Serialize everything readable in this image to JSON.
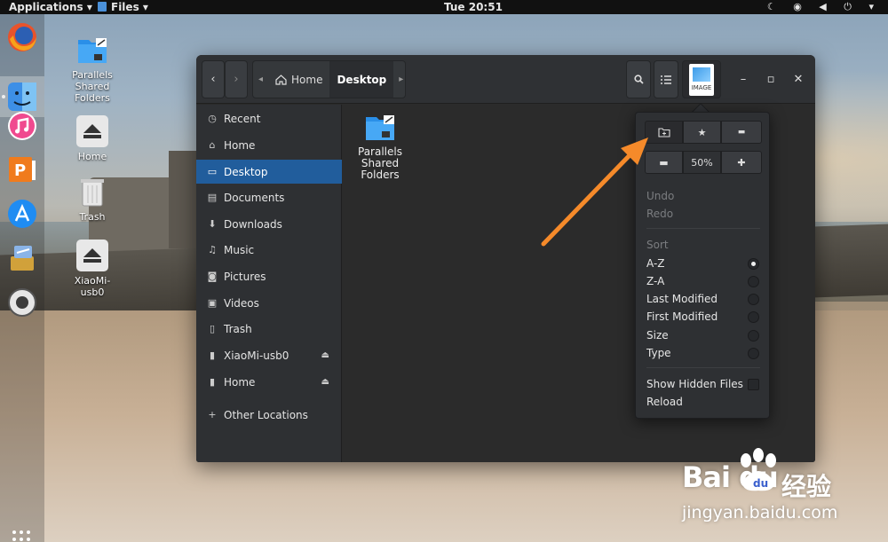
{
  "topbar": {
    "applications": "Applications ▾",
    "files": "Files ▾",
    "clock": "Tue 20:51",
    "tray": "☾ ◉ ◀ ⏻ ▾"
  },
  "desktop_icons": [
    {
      "label": "Parallels Shared Folders"
    },
    {
      "label": "Home"
    },
    {
      "label": "Trash"
    },
    {
      "label": "XiaoMi-usb0"
    }
  ],
  "window": {
    "crumb_home": "Home",
    "crumb_current": "Desktop",
    "thumb_label": "IMAGE",
    "sidebar": [
      {
        "label": "Recent",
        "icon": "clock-icon"
      },
      {
        "label": "Home",
        "icon": "home-icon"
      },
      {
        "label": "Desktop",
        "icon": "desktop-icon",
        "selected": true
      },
      {
        "label": "Documents",
        "icon": "document-icon"
      },
      {
        "label": "Downloads",
        "icon": "download-icon"
      },
      {
        "label": "Music",
        "icon": "music-icon"
      },
      {
        "label": "Pictures",
        "icon": "camera-icon"
      },
      {
        "label": "Videos",
        "icon": "film-icon"
      },
      {
        "label": "Trash",
        "icon": "trash-icon"
      },
      {
        "label": "XiaoMi-usb0",
        "icon": "drive-icon",
        "eject": true
      },
      {
        "label": "Home",
        "icon": "drive-icon",
        "eject": true
      },
      {
        "label": "Other Locations",
        "icon": "plus-icon"
      }
    ],
    "content_items": [
      {
        "label": "Parallels Shared Folders"
      }
    ]
  },
  "menu": {
    "zoom": "50%",
    "undo": "Undo",
    "redo": "Redo",
    "sort_header": "Sort",
    "sort_options": [
      {
        "label": "A-Z",
        "selected": true
      },
      {
        "label": "Z-A",
        "selected": false
      },
      {
        "label": "Last Modified",
        "selected": false
      },
      {
        "label": "First Modified",
        "selected": false
      },
      {
        "label": "Size",
        "selected": false
      },
      {
        "label": "Type",
        "selected": false
      }
    ],
    "show_hidden": "Show Hidden Files",
    "show_hidden_checked": false,
    "reload": "Reload"
  },
  "watermark": {
    "brand": "Bai  du",
    "cn": "经验",
    "url": "jingyan.baidu.com"
  },
  "colors": {
    "accent": "#215d9c",
    "arrow": "#f58a2a"
  }
}
